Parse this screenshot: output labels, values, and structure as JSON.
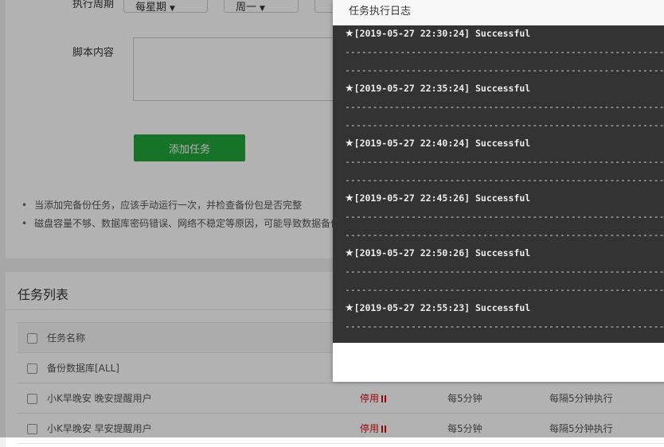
{
  "form": {
    "cycle_label": "执行周期",
    "cycle_select_1": "每星期",
    "cycle_select_2": "周一",
    "script_label": "脚本内容",
    "script_value": "",
    "add_button": "添加任务",
    "tips": [
      "当添加完备份任务，应该手动运行一次，并检查备份包是否完整",
      "磁盘容量不够、数据库密码错误、网络不稳定等原因，可能导致数据备份"
    ]
  },
  "task_list": {
    "title": "任务列表",
    "header": {
      "name": "任务名称"
    },
    "rows": [
      {
        "name": "备份数据库[ALL]",
        "status": "",
        "cycle": "",
        "exec": ""
      },
      {
        "name": "小K早晚安 晚安提醒用户",
        "status": "停用",
        "cycle": "每5分钟",
        "exec": "每隔5分钟执行"
      },
      {
        "name": "小K早晚安 早安提醒用户",
        "status": "停用",
        "cycle": "每5分钟",
        "exec": "每隔5分钟执行"
      }
    ]
  },
  "log_modal": {
    "title": "任务执行日志",
    "star_glyph": "★",
    "separator": "--------------------------------------------------------------------------",
    "entries": [
      {
        "text": "[2019-05-27 22:30:24] Successful"
      },
      {
        "text": "[2019-05-27 22:35:24] Successful"
      },
      {
        "text": "[2019-05-27 22:40:24] Successful"
      },
      {
        "text": "[2019-05-27 22:45:26] Successful"
      },
      {
        "text": "[2019-05-27 22:50:26] Successful"
      },
      {
        "text": "[2019-05-27 22:55:23] Successful"
      }
    ]
  },
  "colors": {
    "accent_green": "#20a53a",
    "status_red": "#d01010",
    "log_background": "#333333"
  }
}
